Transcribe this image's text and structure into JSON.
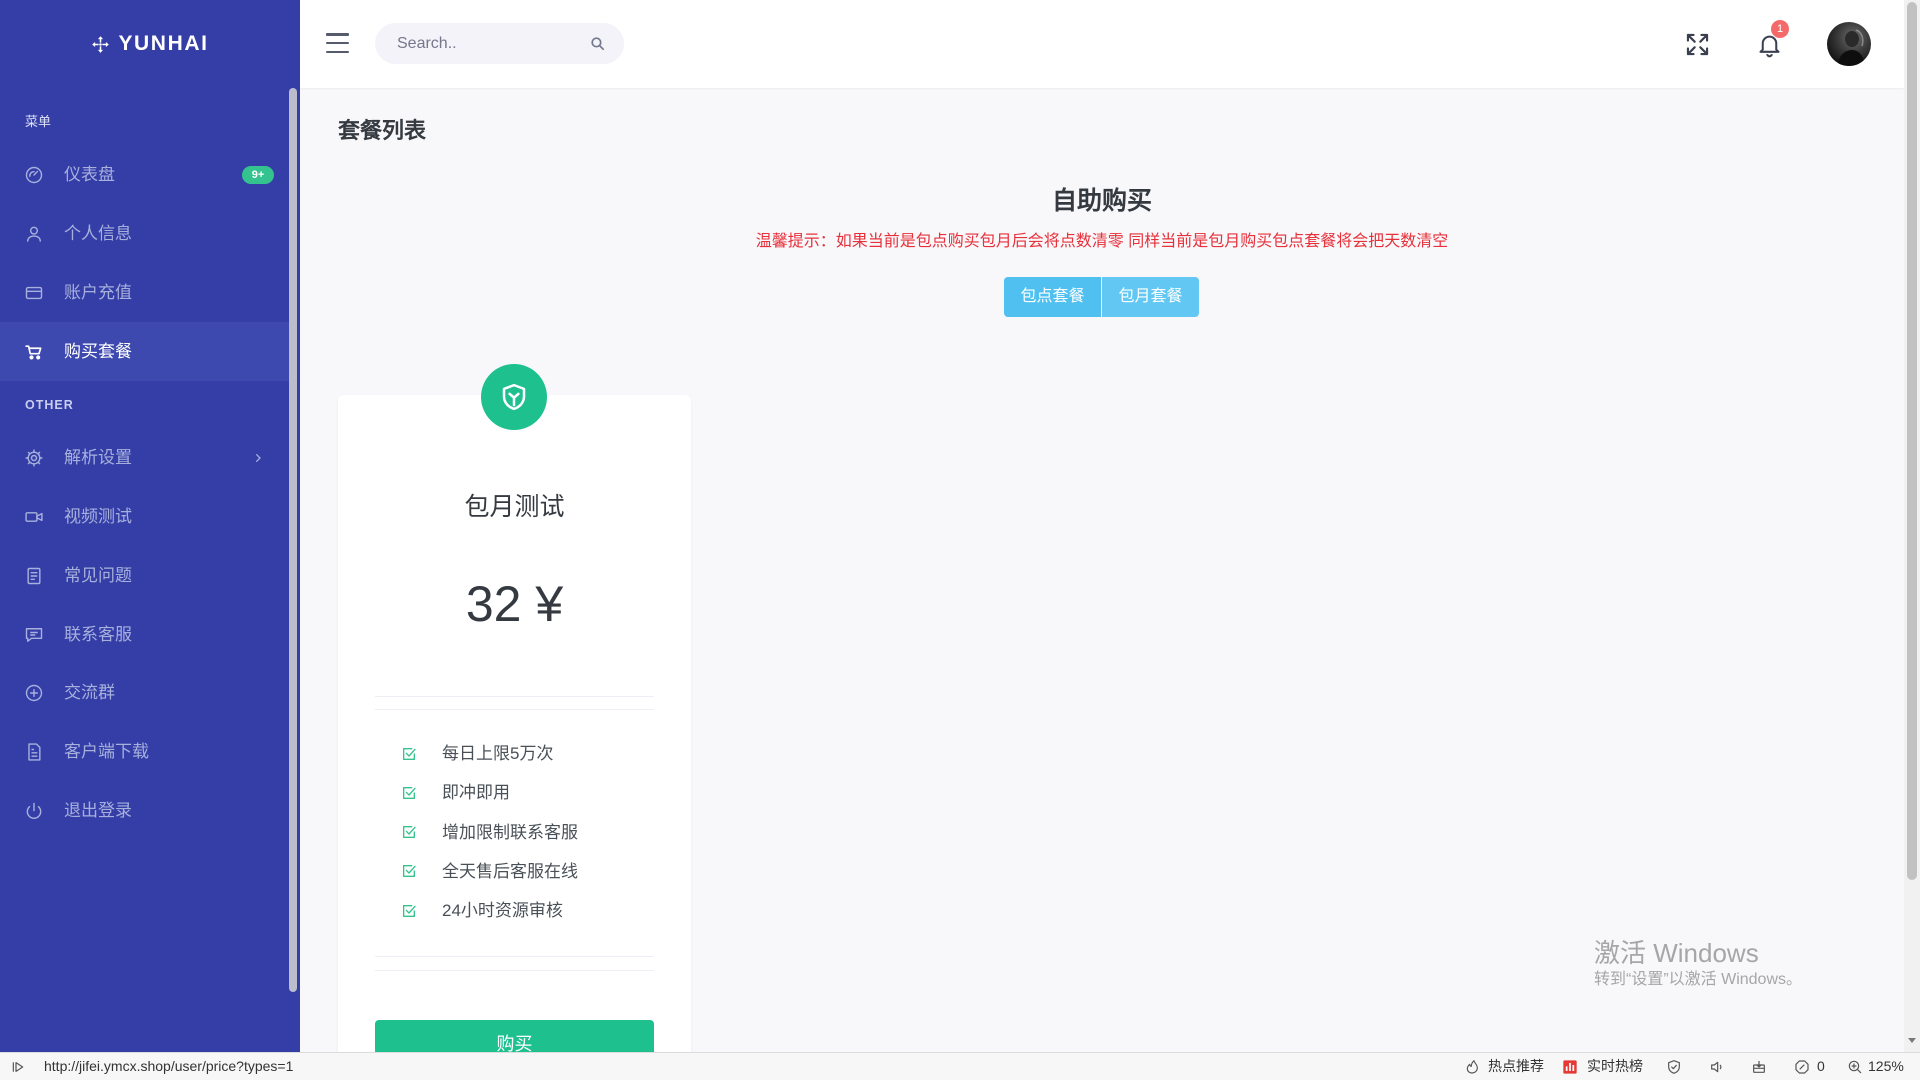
{
  "theme": {
    "sidebar_bg": "#343ea6",
    "sidebar_active": "#3e49b0",
    "accent_green": "#1ec08e",
    "tab_blue": "#50c0f0",
    "notice_red": "#e8303a"
  },
  "app": {
    "logo_text": "YUNHAI",
    "logo_icon": "move-arrows-icon"
  },
  "sidebar": {
    "section_menu": "菜单",
    "section_other": "OTHER",
    "items": [
      {
        "label": "仪表盘",
        "icon": "dashboard-icon",
        "badge": "9+"
      },
      {
        "label": "个人信息",
        "icon": "user-icon"
      },
      {
        "label": "账户充值",
        "icon": "credit-card-icon"
      },
      {
        "label": "购买套餐",
        "icon": "cart-icon",
        "active": true
      }
    ],
    "other_items": [
      {
        "label": "解析设置",
        "icon": "settings-icon",
        "has_submenu": true
      },
      {
        "label": "视频测试",
        "icon": "video-icon"
      },
      {
        "label": "常见问题",
        "icon": "document-icon"
      },
      {
        "label": "联系客服",
        "icon": "chat-icon"
      },
      {
        "label": "交流群",
        "icon": "plus-circle-icon"
      },
      {
        "label": "客户端下载",
        "icon": "file-download-icon"
      },
      {
        "label": "退出登录",
        "icon": "power-icon"
      }
    ]
  },
  "header": {
    "search_placeholder": "Search..",
    "notification_count": "1"
  },
  "page": {
    "title": "套餐列表",
    "heading": "自助购买",
    "notice": "温馨提示：如果当前是包点购买包月后会将点数清零 同样当前是包月购买包点套餐将会把天数清空",
    "tabs": [
      {
        "label": "包点套餐"
      },
      {
        "label": "包月套餐"
      }
    ]
  },
  "plan": {
    "icon": "shield-icon",
    "name": "包月测试",
    "price": "32 ¥",
    "features": [
      "每日上限5万次",
      "即冲即用",
      "增加限制联系客服",
      "全天售后客服在线",
      "24小时资源审核"
    ],
    "buy_label": "购买"
  },
  "watermark": {
    "line1": "激活 Windows",
    "line2": "转到“设置”以激活 Windows。"
  },
  "statusbar": {
    "url": "http://jifei.ymcx.shop/user/price?types=1",
    "hot_recommend": "热点推荐",
    "hot_list": "实时热榜",
    "block_count": "0",
    "zoom": "125%"
  }
}
